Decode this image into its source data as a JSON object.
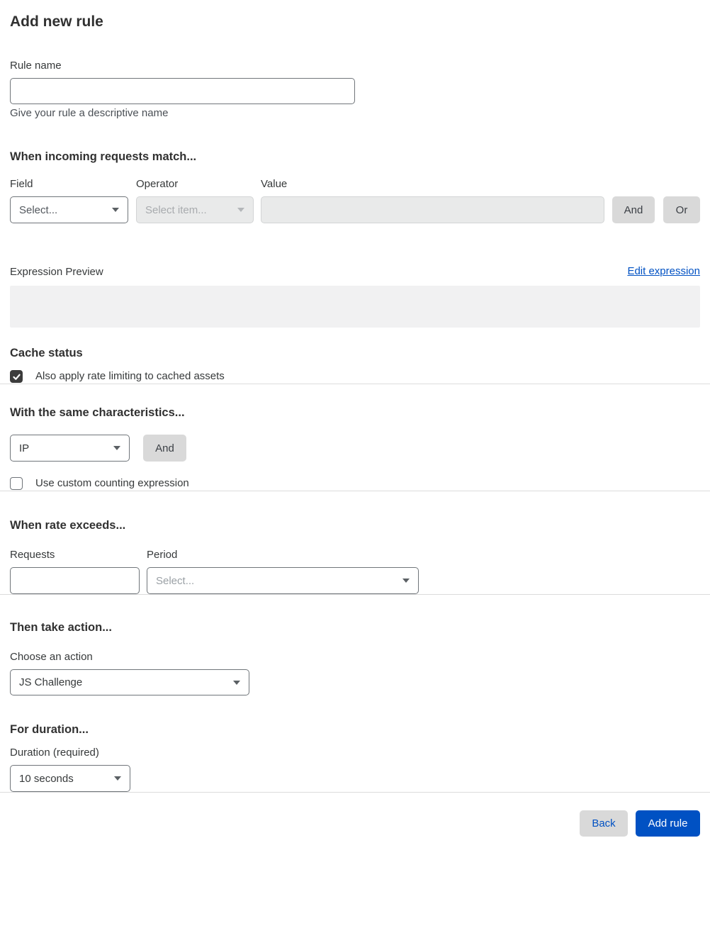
{
  "page": {
    "title": "Add new rule"
  },
  "rule_name": {
    "label": "Rule name",
    "value": "",
    "helper": "Give your rule a descriptive name"
  },
  "match_section": {
    "heading": "When incoming requests match...",
    "field": {
      "label": "Field",
      "selected": "Select..."
    },
    "operator": {
      "label": "Operator",
      "selected": "Select item..."
    },
    "value": {
      "label": "Value",
      "value": ""
    },
    "and_button": "And",
    "or_button": "Or",
    "expression_preview_label": "Expression Preview",
    "edit_expression_link": "Edit expression",
    "expression_value": ""
  },
  "cache_status": {
    "heading": "Cache status",
    "checkbox_label": "Also apply rate limiting to cached assets",
    "checked": true
  },
  "characteristics": {
    "heading": "With the same characteristics...",
    "selected": "IP",
    "and_button": "And",
    "checkbox_label": "Use custom counting expression",
    "checked": false
  },
  "rate_section": {
    "heading": "When rate exceeds...",
    "requests_label": "Requests",
    "requests_value": "",
    "period_label": "Period",
    "period_selected": "Select..."
  },
  "action_section": {
    "heading": "Then take action...",
    "label": "Choose an action",
    "selected": "JS Challenge"
  },
  "duration_section": {
    "heading": "For duration...",
    "label": "Duration (required)",
    "selected": "10 seconds"
  },
  "footer": {
    "back_label": "Back",
    "add_rule_label": "Add rule"
  },
  "colors": {
    "accent_blue": "#0051c3",
    "button_gray": "#d9d9d9",
    "checkbox_dark": "#3b3b3b"
  }
}
